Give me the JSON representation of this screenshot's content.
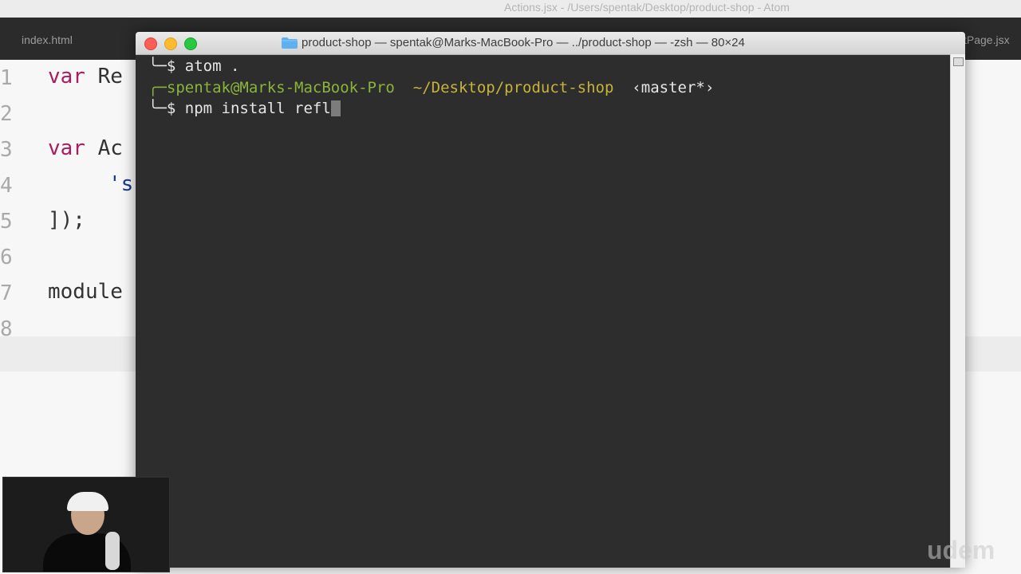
{
  "atom": {
    "window_title": "Actions.jsx - /Users/spentak/Desktop/product-shop - Atom",
    "tab_left": "index.html",
    "tab_right": "tPage.jsx",
    "gutter": [
      "1",
      "2",
      "3",
      "4",
      "5",
      "6",
      "7",
      "8"
    ],
    "code": {
      "line1_kw": "var",
      "line1_rest": " Re",
      "line3_kw": "var",
      "line3_rest": " Ac",
      "line4_str": "'s",
      "line5": "]);",
      "line7": "module"
    }
  },
  "terminal": {
    "title": "product-shop — spentak@Marks-MacBook-Pro — ../product-shop — -zsh — 80×24",
    "line1_prompt": "╰─$ ",
    "line1_cmd": "atom .",
    "line2_prefix": "╭─",
    "line2_user": "spentak@Marks-MacBook-Pro",
    "line2_path": "~/Desktop/product-shop",
    "line2_branch": "‹master*›",
    "line3_prompt": "╰─$ ",
    "line3_cmd": "npm install refl"
  },
  "watermark": "udem"
}
